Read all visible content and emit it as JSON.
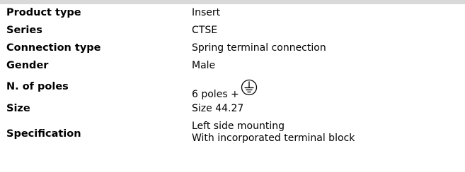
{
  "rows": [
    {
      "label": "Product type",
      "value": "Insert"
    },
    {
      "label": "Series",
      "value": "CTSE"
    },
    {
      "label": "Connection type",
      "value": "Spring terminal connection"
    },
    {
      "label": "Gender",
      "value": "Male"
    },
    {
      "label": "N. of poles",
      "value": "6 poles +",
      "icon": "protective-earth-icon"
    },
    {
      "label": "Size",
      "value": "Size 44.27"
    },
    {
      "label": "Specification",
      "value_line1": "Left side mounting",
      "value_line2": "With incorporated terminal block"
    }
  ]
}
